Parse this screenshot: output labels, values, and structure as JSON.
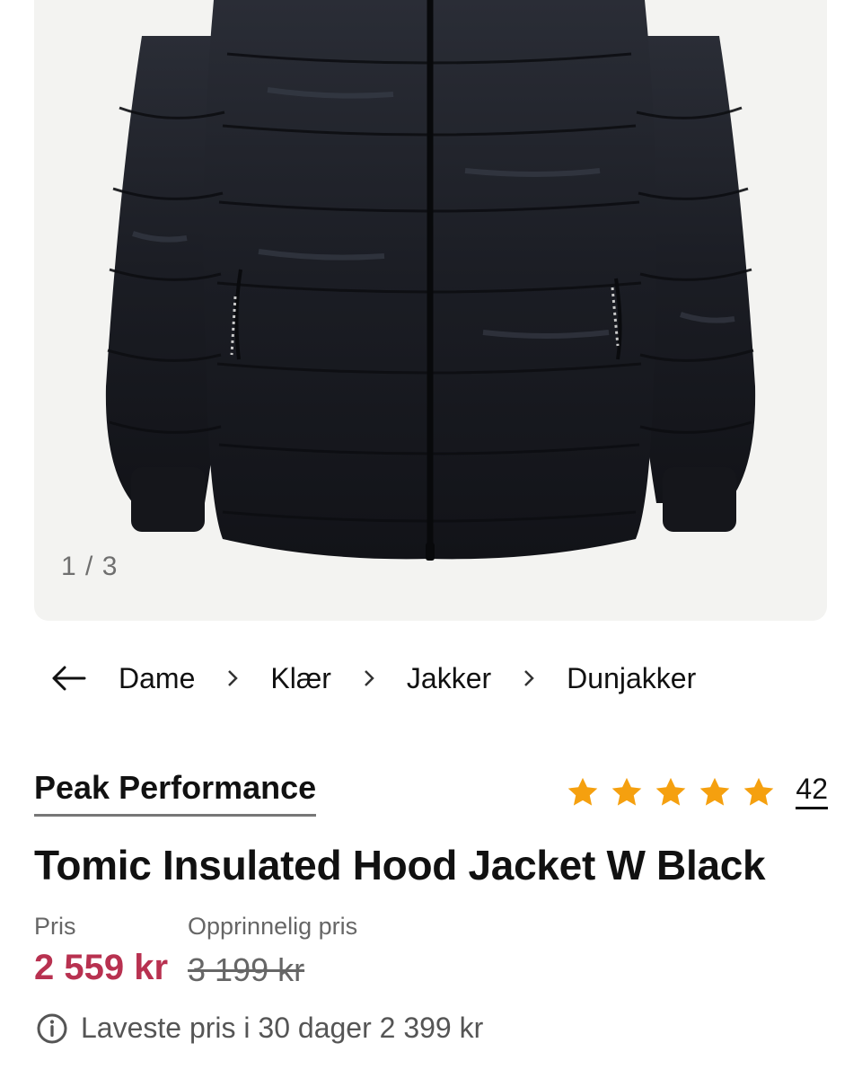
{
  "gallery": {
    "image_alt": "Tomic Insulated Hood Jacket W Black",
    "counter": "1 / 3"
  },
  "breadcrumb": {
    "items": [
      "Dame",
      "Klær",
      "Jakker",
      "Dunjakker"
    ]
  },
  "product": {
    "brand": "Peak Performance",
    "title": "Tomic Insulated Hood Jacket W Black",
    "rating": {
      "stars": 5,
      "max_stars": 5,
      "review_count": "42"
    }
  },
  "price": {
    "current_label": "Pris",
    "current": "2 559 kr",
    "original_label": "Opprinnelig pris",
    "original": "3 199 kr",
    "lowest_text": "Laveste pris i 30 dager 2 399 kr"
  },
  "colors": {
    "sale_price": "#b83150",
    "star": "#f5a00f",
    "gallery_bg": "#f3f3f1",
    "jacket": "#1b1d24"
  },
  "icons": [
    "back-arrow-icon",
    "chevron-right-icon",
    "star-icon",
    "info-icon"
  ]
}
